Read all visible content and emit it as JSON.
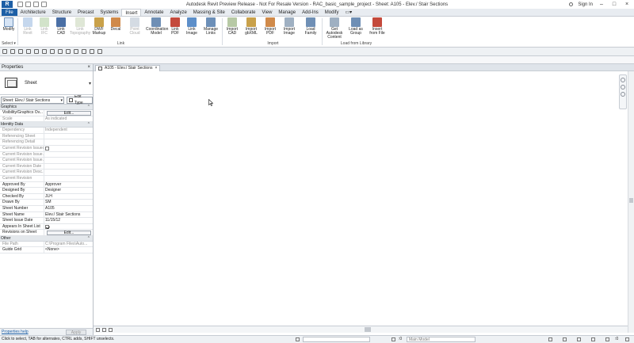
{
  "window": {
    "title": "Autodesk Revit Preview Release - Not For Resale Version - RAC_basic_sample_project - Sheet: A105 - Elev./ Stair Sections",
    "logo": "R",
    "sign_in": "Sign In"
  },
  "ribbon_tabs": [
    "File",
    "Architecture",
    "Structure",
    "Precast",
    "Systems",
    "Insert",
    "Annotate",
    "Analyze",
    "Massing & Site",
    "Collaborate",
    "View",
    "Manage",
    "Add-Ins",
    "Modify"
  ],
  "ribbon_active_tab": "Insert",
  "ribbon": {
    "modify": "Modify",
    "select": "Select ▾",
    "link": [
      {
        "label": "Link\nRevit",
        "disabled": true
      },
      {
        "label": "Link\nIFC",
        "disabled": true
      },
      {
        "label": "Link\nCAD",
        "disabled": false
      },
      {
        "label": "Link\nTopography",
        "disabled": true
      },
      {
        "label": "DWF\nMarkup",
        "disabled": false
      },
      {
        "label": "Decal",
        "disabled": false
      },
      {
        "label": "Point\nCloud",
        "disabled": true
      },
      {
        "label": "Coordination\nModel",
        "disabled": false
      },
      {
        "label": "Link\nPDF",
        "disabled": false
      },
      {
        "label": "Link\nImage",
        "disabled": false
      },
      {
        "label": "Manage\nLinks",
        "disabled": false
      }
    ],
    "import": [
      {
        "label": "Import\nCAD"
      },
      {
        "label": "Import\ngbXML"
      },
      {
        "label": "Import\nPDF"
      },
      {
        "label": "Import\nImage"
      },
      {
        "label": "Load\nFamily"
      }
    ],
    "load": [
      {
        "label": "Get Autodesk\nContent"
      },
      {
        "label": "Load as\nGroup"
      },
      {
        "label": "Insert\nfrom File"
      }
    ],
    "panel_labels": {
      "link": "Link",
      "import": "Import",
      "load": "Load from Library"
    }
  },
  "properties": {
    "title": "Properties",
    "type_name": "Sheet",
    "instance_selector": "Sheet: Elev./ Stair Sections",
    "edit_type": "Edit Type",
    "groups": [
      {
        "name": "Graphics",
        "rows": [
          {
            "k": "Visibility/Graphics Ov...",
            "v": "Edit...",
            "type": "button"
          },
          {
            "k": "Scale",
            "v": "As indicated",
            "ro": true
          }
        ]
      },
      {
        "name": "Identity Data",
        "rows": [
          {
            "k": "Dependency",
            "v": "Independent",
            "ro": true
          },
          {
            "k": "Referencing Sheet",
            "v": "",
            "ro": true
          },
          {
            "k": "Referencing Detail",
            "v": "",
            "ro": true
          },
          {
            "k": "Current Revision Issued",
            "v": "",
            "ro": true,
            "type": "check",
            "checked": false
          },
          {
            "k": "Current Revision Issue...",
            "v": "",
            "ro": true
          },
          {
            "k": "Current Revision Issue...",
            "v": "",
            "ro": true
          },
          {
            "k": "Current Revision Date",
            "v": "",
            "ro": true
          },
          {
            "k": "Current Revision Desc...",
            "v": "",
            "ro": true
          },
          {
            "k": "Current Revision",
            "v": "",
            "ro": true
          },
          {
            "k": "Approved By",
            "v": "Approver"
          },
          {
            "k": "Designed By",
            "v": "Designer"
          },
          {
            "k": "Checked By",
            "v": "JLH"
          },
          {
            "k": "Drawn By",
            "v": "SM"
          },
          {
            "k": "Sheet Number",
            "v": "A105"
          },
          {
            "k": "Sheet Name",
            "v": "Elev./ Stair Sections"
          },
          {
            "k": "Sheet Issue Date",
            "v": "11/15/12"
          },
          {
            "k": "Appears In Sheet List",
            "v": "",
            "type": "check",
            "checked": true
          },
          {
            "k": "Revisions on Sheet",
            "v": "Edit...",
            "type": "button"
          }
        ]
      },
      {
        "name": "Other",
        "rows": [
          {
            "k": "File Path",
            "v": "C:\\Program Files\\Auto...",
            "ro": true
          },
          {
            "k": "Guide Grid",
            "v": "<None>"
          }
        ]
      }
    ],
    "help_link": "Properties help",
    "apply": "Apply"
  },
  "view_tab": "A105 - Elev./ Stair Sections",
  "status": {
    "message": "Click to select, TAB for alternates, CTRL adds, SHIFT unselects.",
    "zero": ":0",
    "model": "Main Model"
  }
}
